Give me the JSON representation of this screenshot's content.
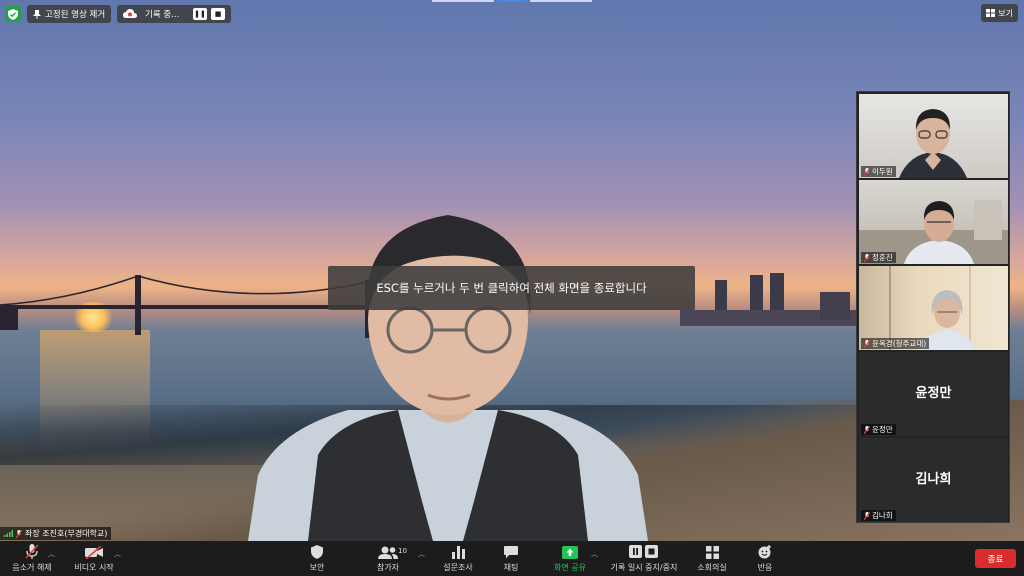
{
  "top": {
    "unpin_label": "고정된 영상 제거",
    "recording_label": "기록 중...",
    "view_label": "보기"
  },
  "banner": {
    "text": "ESC를 누르거나 두 번 클릭하여 전체 화면을 종료합니다"
  },
  "speaker": {
    "name": "좌장 조진호(부경대학교)"
  },
  "gallery": [
    {
      "name": "이두원",
      "video": true
    },
    {
      "name": "정훈진",
      "video": true
    },
    {
      "name": "윤옥경(청주교대)",
      "video": true
    },
    {
      "name": "윤정만",
      "display": "윤정만",
      "video": false
    },
    {
      "name": "김나희",
      "display": "김나희",
      "video": false
    }
  ],
  "toolbar": {
    "mute_label": "음소거 해제",
    "video_label": "비디오 시작",
    "security_label": "보안",
    "participants_label": "참가자",
    "participants_count": "10",
    "poll_label": "설문조사",
    "chat_label": "채팅",
    "share_label": "화면 공유",
    "record_label": "기록 일시 중지/중지",
    "breakout_label": "소회의실",
    "reaction_label": "반응",
    "end_label": "종료"
  },
  "colors": {
    "share_green": "#23c35a",
    "end_red": "#d92c2c",
    "secure_green": "#22a04a"
  }
}
